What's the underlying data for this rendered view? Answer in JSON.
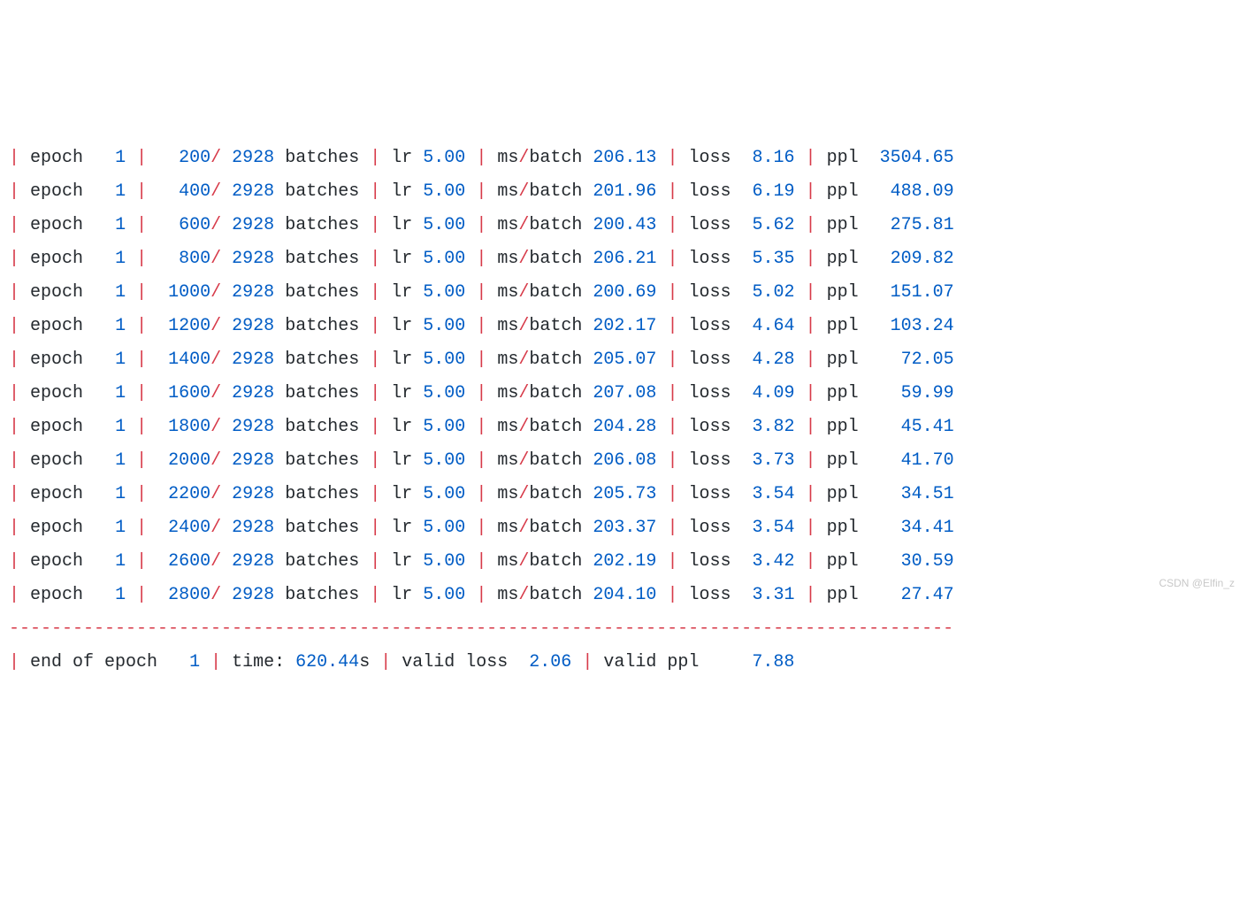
{
  "labels": {
    "epoch": "epoch",
    "batches": "batches",
    "lr": "lr",
    "ms_batch": "batch",
    "ms": "ms",
    "loss": "loss",
    "ppl": "ppl",
    "end_of_epoch": "end of epoch",
    "time": "time:",
    "time_unit": "s",
    "valid_loss": "valid loss",
    "valid_ppl": "valid ppl"
  },
  "total_batches": "2928",
  "lr_value": "5.00",
  "dash_line": "-----------------------------------------------------------------------------------------",
  "rows": [
    {
      "epoch": "1",
      "step": "200",
      "ms": "206.13",
      "loss": "8.16",
      "ppl": "3504.65"
    },
    {
      "epoch": "1",
      "step": "400",
      "ms": "201.96",
      "loss": "6.19",
      "ppl": "488.09"
    },
    {
      "epoch": "1",
      "step": "600",
      "ms": "200.43",
      "loss": "5.62",
      "ppl": "275.81"
    },
    {
      "epoch": "1",
      "step": "800",
      "ms": "206.21",
      "loss": "5.35",
      "ppl": "209.82"
    },
    {
      "epoch": "1",
      "step": "1000",
      "ms": "200.69",
      "loss": "5.02",
      "ppl": "151.07"
    },
    {
      "epoch": "1",
      "step": "1200",
      "ms": "202.17",
      "loss": "4.64",
      "ppl": "103.24"
    },
    {
      "epoch": "1",
      "step": "1400",
      "ms": "205.07",
      "loss": "4.28",
      "ppl": "72.05"
    },
    {
      "epoch": "1",
      "step": "1600",
      "ms": "207.08",
      "loss": "4.09",
      "ppl": "59.99"
    },
    {
      "epoch": "1",
      "step": "1800",
      "ms": "204.28",
      "loss": "3.82",
      "ppl": "45.41"
    },
    {
      "epoch": "1",
      "step": "2000",
      "ms": "206.08",
      "loss": "3.73",
      "ppl": "41.70"
    },
    {
      "epoch": "1",
      "step": "2200",
      "ms": "205.73",
      "loss": "3.54",
      "ppl": "34.51"
    },
    {
      "epoch": "1",
      "step": "2400",
      "ms": "203.37",
      "loss": "3.54",
      "ppl": "34.41"
    },
    {
      "epoch": "1",
      "step": "2600",
      "ms": "202.19",
      "loss": "3.42",
      "ppl": "30.59"
    },
    {
      "epoch": "1",
      "step": "2800",
      "ms": "204.10",
      "loss": "3.31",
      "ppl": "27.47"
    }
  ],
  "summary": {
    "epoch": "1",
    "time": "620.44",
    "valid_loss": "2.06",
    "valid_ppl": "7.88"
  },
  "watermark": "CSDN @Elfin_z"
}
